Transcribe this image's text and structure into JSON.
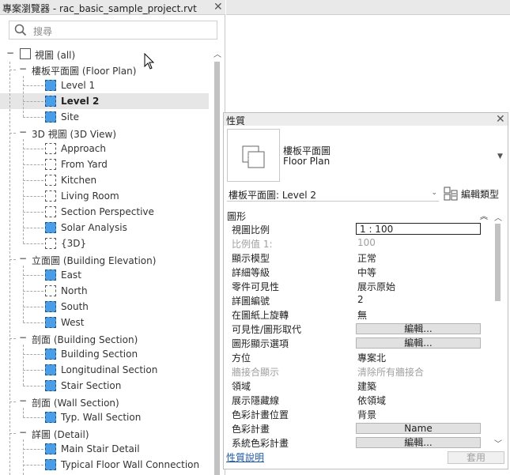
{
  "project_browser": {
    "title": "專案瀏覽器 - rac_basic_sample_project.rvt",
    "search_placeholder": "搜尋",
    "tree": [
      {
        "label": "視圖 (all)",
        "level": 0,
        "expander": "−",
        "icon": "views-root-icon"
      },
      {
        "label": "樓板平面圖 (Floor Plan)",
        "level": 1,
        "expander": "−"
      },
      {
        "label": "Level 1",
        "level": 2,
        "icon": "filled"
      },
      {
        "label": "Level 2",
        "level": 2,
        "icon": "filled",
        "selected": true
      },
      {
        "label": "Site",
        "level": 2,
        "icon": "filled"
      },
      {
        "label": "3D 視圖 (3D View)",
        "level": 1,
        "expander": "−"
      },
      {
        "label": "Approach",
        "level": 2,
        "icon": "outline"
      },
      {
        "label": "From Yard",
        "level": 2,
        "icon": "outline"
      },
      {
        "label": "Kitchen",
        "level": 2,
        "icon": "outline"
      },
      {
        "label": "Living Room",
        "level": 2,
        "icon": "outline"
      },
      {
        "label": "Section Perspective",
        "level": 2,
        "icon": "outline"
      },
      {
        "label": "Solar Analysis",
        "level": 2,
        "icon": "filled"
      },
      {
        "label": "{3D}",
        "level": 2,
        "icon": "outline"
      },
      {
        "label": "立面圖 (Building Elevation)",
        "level": 1,
        "expander": "−"
      },
      {
        "label": "East",
        "level": 2,
        "icon": "filled"
      },
      {
        "label": "North",
        "level": 2,
        "icon": "outline"
      },
      {
        "label": "South",
        "level": 2,
        "icon": "filled"
      },
      {
        "label": "West",
        "level": 2,
        "icon": "filled"
      },
      {
        "label": "剖面 (Building Section)",
        "level": 1,
        "expander": "−"
      },
      {
        "label": "Building Section",
        "level": 2,
        "icon": "filled"
      },
      {
        "label": "Longitudinal Section",
        "level": 2,
        "icon": "filled"
      },
      {
        "label": "Stair Section",
        "level": 2,
        "icon": "filled"
      },
      {
        "label": "剖面 (Wall Section)",
        "level": 1,
        "expander": "−"
      },
      {
        "label": "Typ. Wall Section",
        "level": 2,
        "icon": "filled"
      },
      {
        "label": "詳圖 (Detail)",
        "level": 1,
        "expander": "−"
      },
      {
        "label": "Main Stair Detail",
        "level": 2,
        "icon": "filled"
      },
      {
        "label": "Typical Floor Wall Connection",
        "level": 2,
        "icon": "filled"
      }
    ]
  },
  "properties": {
    "title": "性質",
    "type_name_line1": "樓板平面圖",
    "type_name_line2": "Floor Plan",
    "instance_selector": "樓板平面圖: Level 2",
    "edit_type_label": "編輯類型",
    "section": "圖形",
    "rows": [
      {
        "key": "視圖比例",
        "value": "1 : 100",
        "kind": "input"
      },
      {
        "key": "比例值 1:",
        "value": "100",
        "kind": "text",
        "disabled": true
      },
      {
        "key": "顯示模型",
        "value": "正常",
        "kind": "text"
      },
      {
        "key": "詳細等級",
        "value": "中等",
        "kind": "text"
      },
      {
        "key": "零件可見性",
        "value": "展示原始",
        "kind": "text"
      },
      {
        "key": "詳圖編號",
        "value": "2",
        "kind": "text"
      },
      {
        "key": "在圖紙上旋轉",
        "value": "無",
        "kind": "text"
      },
      {
        "key": "可見性/圖形取代",
        "value": "編輯...",
        "kind": "button"
      },
      {
        "key": "圖形顯示選項",
        "value": "編輯...",
        "kind": "button"
      },
      {
        "key": "方位",
        "value": "專案北",
        "kind": "text"
      },
      {
        "key": "牆接合顯示",
        "value": "清除所有牆接合",
        "kind": "text",
        "disabled": true
      },
      {
        "key": "領域",
        "value": "建築",
        "kind": "text"
      },
      {
        "key": "展示隱藏線",
        "value": "依領域",
        "kind": "text"
      },
      {
        "key": "色彩計畫位置",
        "value": "背景",
        "kind": "text"
      },
      {
        "key": "色彩計畫",
        "value": "Name",
        "kind": "button"
      },
      {
        "key": "系統色彩計畫",
        "value": "編輯...",
        "kind": "button"
      }
    ],
    "help_link": "性質說明",
    "apply_label": "套用"
  },
  "colors": {
    "view_icon_fill": "#4a9ee8",
    "selected_row": "#e6e6e6",
    "link": "#1f5aa8"
  }
}
